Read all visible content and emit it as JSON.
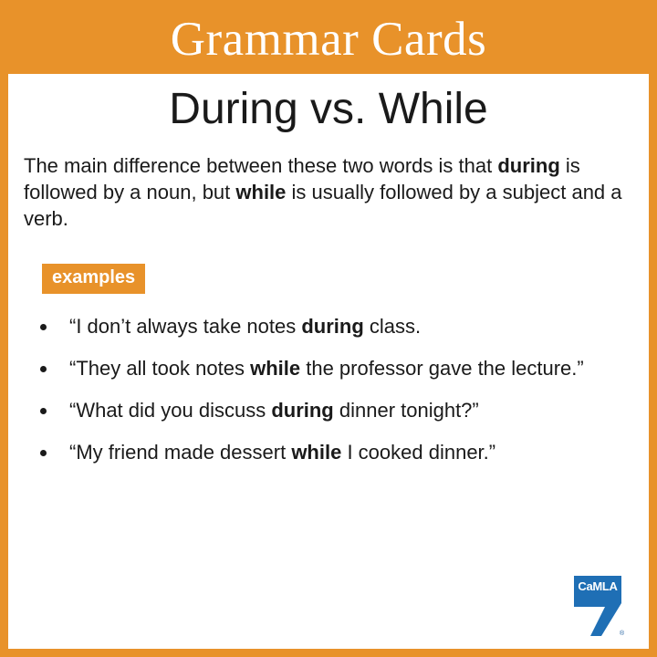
{
  "header": {
    "title": "Grammar Cards"
  },
  "card": {
    "subtitle": "During vs. While",
    "intro": {
      "t1": "The main difference between these two words is that ",
      "b1": "during",
      "t2": " is followed by a noun, but ",
      "b2": "while",
      "t3": " is usually followed by a subject and a verb."
    },
    "examples_label": "examples",
    "examples": [
      {
        "pre": "“I don’t always take notes ",
        "bold": "during",
        "post": " class."
      },
      {
        "pre": "“They all took notes ",
        "bold": "while",
        "post": " the professor gave the lecture.”"
      },
      {
        "pre": "“What did you discuss ",
        "bold": "during",
        "post": " dinner tonight?”"
      },
      {
        "pre": "“My friend made dessert ",
        "bold": "while",
        "post": " I cooked dinner.”"
      }
    ]
  },
  "logo": {
    "text": "CaMLA",
    "reg": "®",
    "icon": "camla-logo-icon"
  },
  "colors": {
    "accent": "#e8922a",
    "logo_blue": "#1f6fb5",
    "text": "#1a1a1a"
  }
}
